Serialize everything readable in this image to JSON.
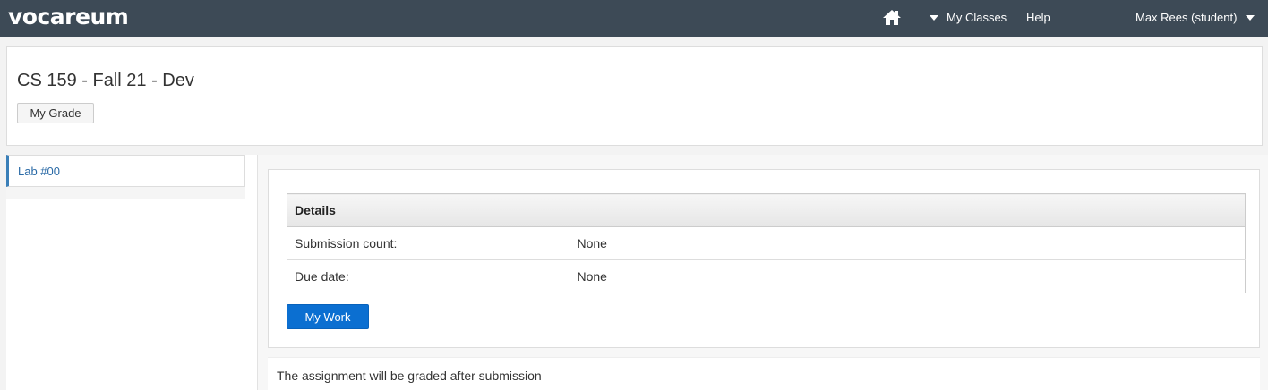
{
  "topbar": {
    "logo": "vocareum",
    "home_icon": "home-icon",
    "my_classes": "My Classes",
    "help": "Help",
    "user": "Max Rees (student)"
  },
  "course": {
    "title": "CS 159 - Fall 21 - Dev",
    "grade_button": "My Grade"
  },
  "sidebar": {
    "items": [
      {
        "label": "Lab #00"
      }
    ]
  },
  "details": {
    "header": "Details",
    "rows": [
      {
        "label": "Submission count:",
        "value": "None"
      },
      {
        "label": "Due date:",
        "value": "None"
      }
    ],
    "work_button": "My Work",
    "note": "The assignment will be graded after submission"
  },
  "colors": {
    "topbar": "#3d4a56",
    "primary_button": "#0b6fd1",
    "sidebar_accent": "#3a7fb8"
  }
}
